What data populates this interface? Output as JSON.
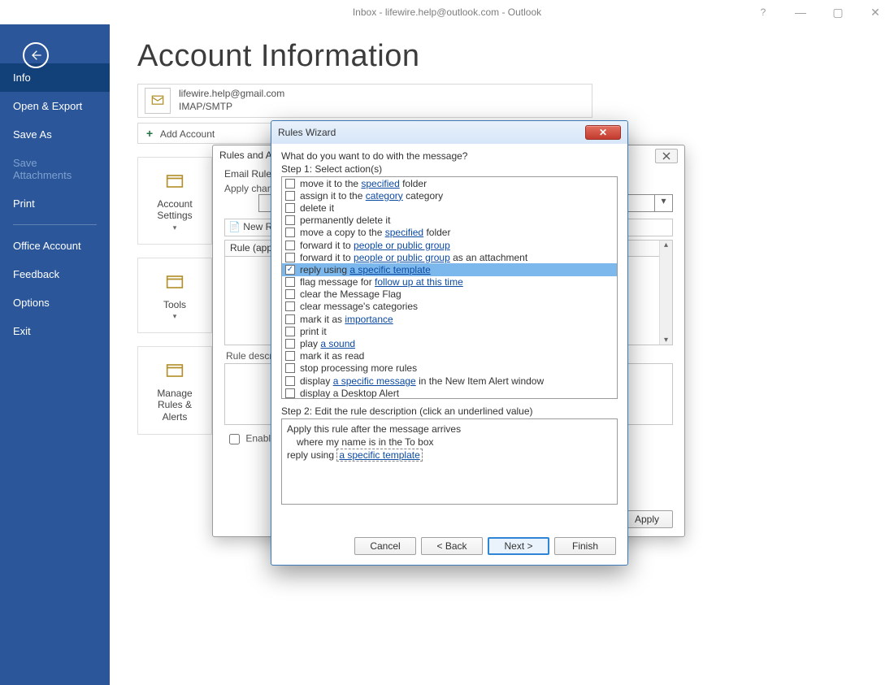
{
  "window": {
    "title": "Inbox - lifewire.help@outlook.com  -  Outlook",
    "help_glyph": "?",
    "min_glyph": "—",
    "max_glyph": "▢",
    "close_glyph": "✕"
  },
  "sidebar": {
    "items": [
      {
        "label": "Info",
        "active": true
      },
      {
        "label": "Open & Export"
      },
      {
        "label": "Save As"
      },
      {
        "label": "Save Attachments",
        "disabled": true
      },
      {
        "label": "Print"
      },
      {
        "label": "Office Account",
        "sep_before": true
      },
      {
        "label": "Feedback"
      },
      {
        "label": "Options"
      },
      {
        "label": "Exit"
      }
    ]
  },
  "main": {
    "page_title": "Account Information",
    "account": {
      "email": "lifewire.help@gmail.com",
      "proto": "IMAP/SMTP"
    },
    "add_account_label": "Add Account",
    "tiles": [
      {
        "label": "Account Settings",
        "hasdd": true,
        "icon": "person-gear"
      },
      {
        "label": "Tools",
        "hasdd": true,
        "icon": "mailbox"
      },
      {
        "label": "Manage Rules & Alerts",
        "hasdd": false,
        "icon": "rules"
      }
    ]
  },
  "rulesDialog": {
    "title": "Rules and Alerts",
    "tab1": "Email Rules",
    "apply_label": "Apply changes to this folder:",
    "toolbar_new": "New Rule...",
    "list_header": "Rule (applied in the order shown)",
    "desc_label": "Rule description (click an underlined value to edit):",
    "enable_label": "Enable rules on all messages downloaded from RSS Feeds",
    "apply_btn": "Apply",
    "close_glyph": "✕"
  },
  "wizard": {
    "title": "Rules Wizard",
    "close_glyph": "✕",
    "q": "What do you want to do with the message?",
    "step1": "Step 1: Select action(s)",
    "step2": "Step 2: Edit the rule description (click an underlined value)",
    "actions": [
      {
        "pre": "move it to the ",
        "link": "specified",
        "post": " folder"
      },
      {
        "pre": "assign it to the ",
        "link": "category",
        "post": " category"
      },
      {
        "pre": "delete it"
      },
      {
        "pre": "permanently delete it"
      },
      {
        "pre": "move a copy to the ",
        "link": "specified",
        "post": " folder"
      },
      {
        "pre": "forward it to ",
        "link": "people or public group"
      },
      {
        "pre": "forward it to ",
        "link": "people or public group",
        "post": " as an attachment"
      },
      {
        "pre": "reply using ",
        "link": "a specific template",
        "checked": true,
        "selected": true
      },
      {
        "pre": "flag message for ",
        "link": "follow up at this time"
      },
      {
        "pre": "clear the Message Flag"
      },
      {
        "pre": "clear message's categories"
      },
      {
        "pre": "mark it as ",
        "link": "importance"
      },
      {
        "pre": "print it"
      },
      {
        "pre": "play ",
        "link": "a sound"
      },
      {
        "pre": "mark it as read"
      },
      {
        "pre": "stop processing more rules"
      },
      {
        "pre": "display ",
        "link": "a specific message",
        "post": " in the New Item Alert window"
      },
      {
        "pre": "display a Desktop Alert"
      }
    ],
    "desc": {
      "line1": "Apply this rule after the message arrives",
      "line2": "where my name is in the To box",
      "line3_pre": "reply using ",
      "line3_link": "a specific template"
    },
    "buttons": {
      "cancel": "Cancel",
      "back": "<  Back",
      "next": "Next  >",
      "finish": "Finish"
    }
  }
}
